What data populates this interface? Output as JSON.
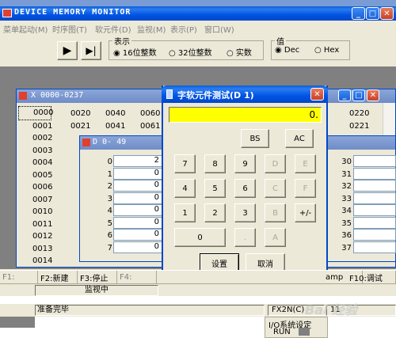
{
  "main_window": {
    "title": "DEVICE MEMORY MONITOR",
    "controls": [
      "_",
      "□",
      "X"
    ]
  },
  "menubar": [
    "菜单起动(M)",
    "时序图(T)",
    "软元件(D)",
    "监视(M)",
    "表示(P)",
    "窗口(W)"
  ],
  "display_group": {
    "label": "表示",
    "options": [
      "16位整数",
      "32位整数",
      "实数"
    ],
    "selected": "16位整数"
  },
  "value_group": {
    "label": "值",
    "options": [
      "Dec",
      "Hex"
    ],
    "selected": "Dec"
  },
  "x_window": {
    "title": "X  0000-0237",
    "col1": [
      "0000",
      "0001",
      "0002",
      "0003",
      "0004",
      "0005",
      "0006",
      "0007",
      "0010",
      "0011",
      "0012",
      "0013",
      "0014"
    ],
    "col2": [
      "0020",
      "0021"
    ],
    "col3": [
      "0040",
      "0041"
    ],
    "col4": [
      "0060",
      "0061"
    ],
    "col5": [
      "0220",
      "0221"
    ]
  },
  "d_window": {
    "title": "D  0- 49",
    "left_idx": [
      "0",
      "1",
      "2",
      "3",
      "4",
      "5",
      "6",
      "7"
    ],
    "left_vals": [
      "2",
      "0",
      "0",
      "0",
      "0",
      "0",
      "0",
      "0"
    ],
    "right_idx": [
      "30",
      "31",
      "32",
      "33",
      "34",
      "35",
      "36",
      "37"
    ]
  },
  "calculator": {
    "title": "字软元件测试(D 1)",
    "display": "0.",
    "bs": "BS",
    "ac": "AC",
    "keys": [
      [
        "7",
        "8",
        "9",
        "D",
        "E"
      ],
      [
        "4",
        "5",
        "6",
        "C",
        "F"
      ],
      [
        "1",
        "2",
        "3",
        "B",
        "+/-"
      ],
      [
        "0",
        "",
        ".",
        "A",
        ""
      ]
    ],
    "ok": "设置",
    "cancel": "取消"
  },
  "fkeys": [
    "F1:",
    "F2:新建",
    "F3:停止",
    "F4:",
    "",
    "amp",
    "F10:调试"
  ],
  "monitor_label": "监视中",
  "status": {
    "left": "准备完毕",
    "plc": "FX2N(C)",
    "val": "11"
  },
  "io_panel": {
    "title": "I/O系统设定",
    "run": "RUN"
  },
  "watermark": "Bai 经验"
}
